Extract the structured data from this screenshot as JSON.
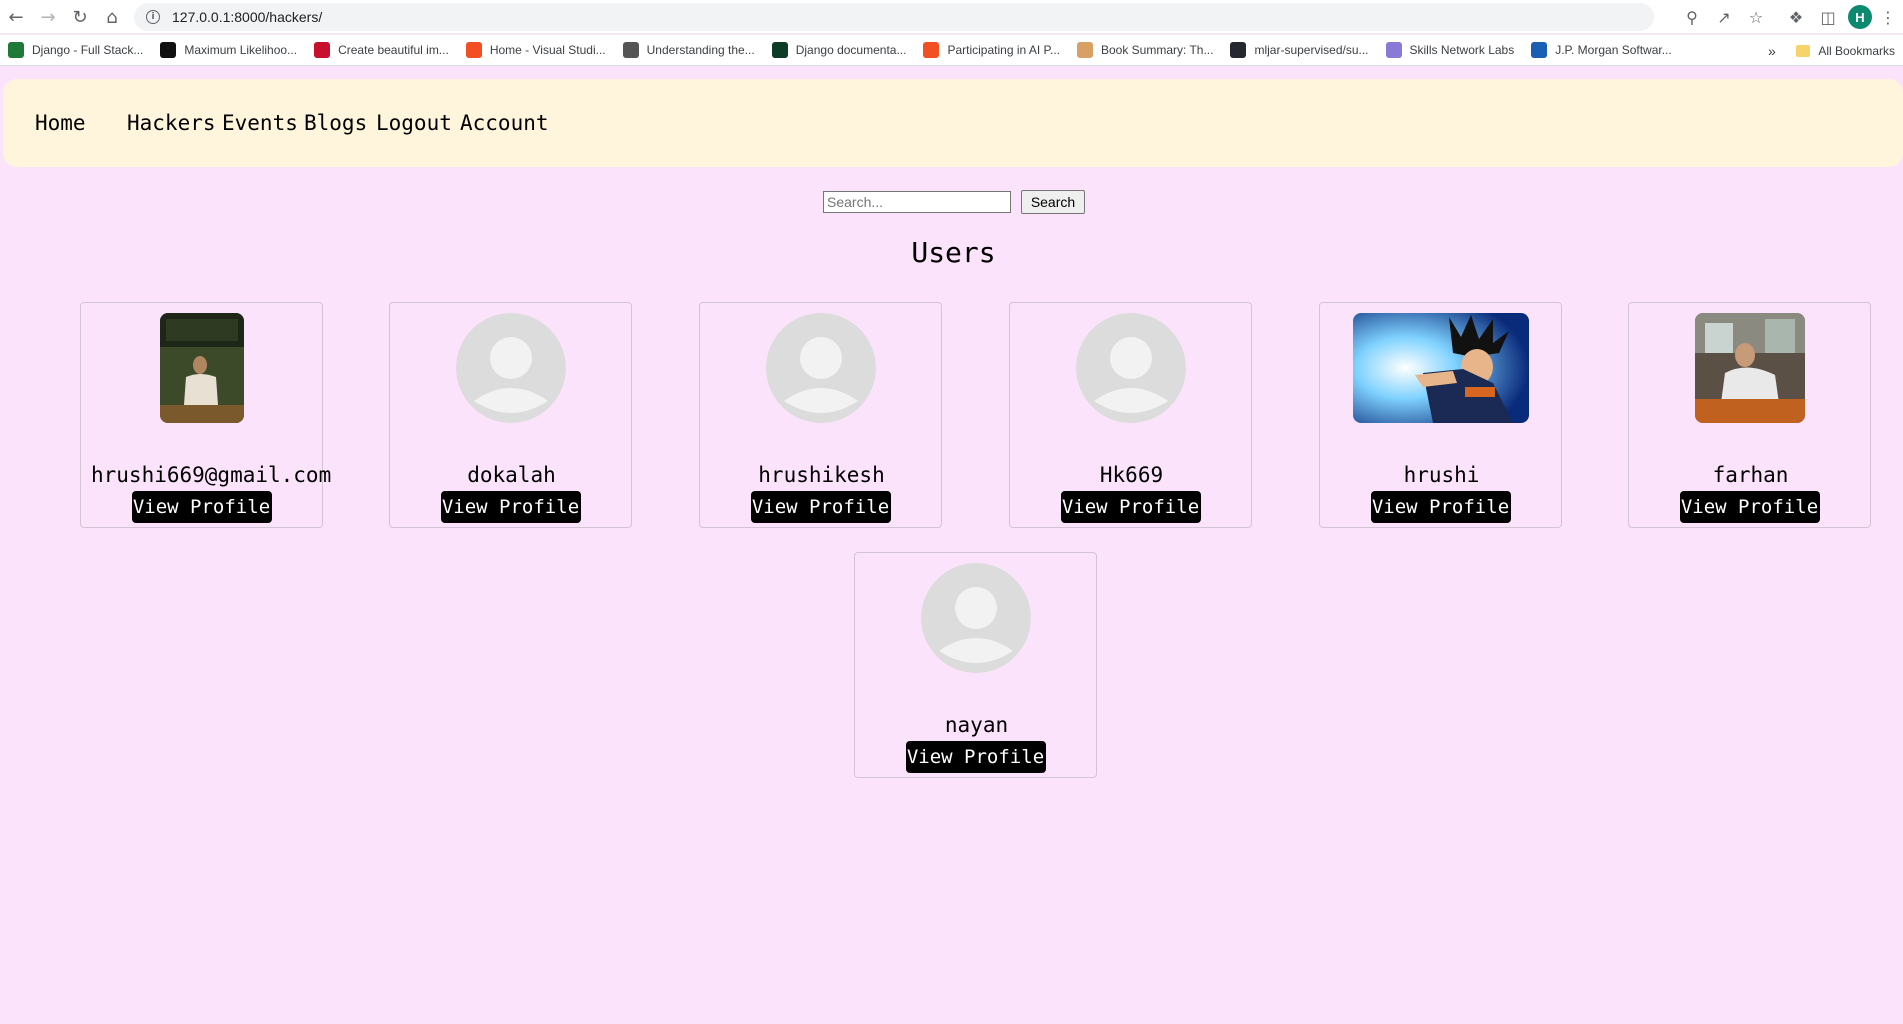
{
  "browser": {
    "url": "127.0.0.1:8000/hackers/",
    "avatar_letter": "H",
    "bookmarks": [
      {
        "label": "Django - Full Stack...",
        "color": "#1f7a3a"
      },
      {
        "label": "Maximum Likelihoo...",
        "color": "#111111"
      },
      {
        "label": "Create beautiful im...",
        "color": "#c8102e"
      },
      {
        "label": "Home - Visual Studi...",
        "color": "#f25022"
      },
      {
        "label": "Understanding the...",
        "color": "#555555"
      },
      {
        "label": "Django documenta...",
        "color": "#0c3c26"
      },
      {
        "label": "Participating in AI P...",
        "color": "#f25022"
      },
      {
        "label": "Book Summary: Th...",
        "color": "#d9a066"
      },
      {
        "label": "mljar-supervised/su...",
        "color": "#24292f"
      },
      {
        "label": "Skills Network Labs",
        "color": "#8a7ad8"
      },
      {
        "label": "J.P. Morgan Softwar...",
        "color": "#1a5fb4"
      }
    ],
    "more_bookmarks": "»",
    "all_bookmarks": "All Bookmarks"
  },
  "navbar": {
    "home": "Home",
    "hackers": "Hackers",
    "events": "Events",
    "blogs": "Blogs",
    "logout": "Logout",
    "account": "Account"
  },
  "search": {
    "placeholder": "Search...",
    "button": "Search"
  },
  "page_title": "Users",
  "users": [
    {
      "name": "hrushi669@gmail.com",
      "button": "View Profile",
      "avatar": "photo-person-outdoors"
    },
    {
      "name": "dokalah",
      "button": "View Profile",
      "avatar": "default-avatar"
    },
    {
      "name": "hrushikesh",
      "button": "View Profile",
      "avatar": "default-avatar"
    },
    {
      "name": "Hk669",
      "button": "View Profile",
      "avatar": "default-avatar"
    },
    {
      "name": "hrushi",
      "button": "View Profile",
      "avatar": "anime-character-image"
    },
    {
      "name": "farhan",
      "button": "View Profile",
      "avatar": "photo-person-cafe"
    },
    {
      "name": "nayan",
      "button": "View Profile",
      "avatar": "default-avatar"
    }
  ],
  "colors": {
    "page_bg": "#fbe4fb",
    "navbar_bg": "#fff5dc",
    "button_bg": "#000000"
  }
}
